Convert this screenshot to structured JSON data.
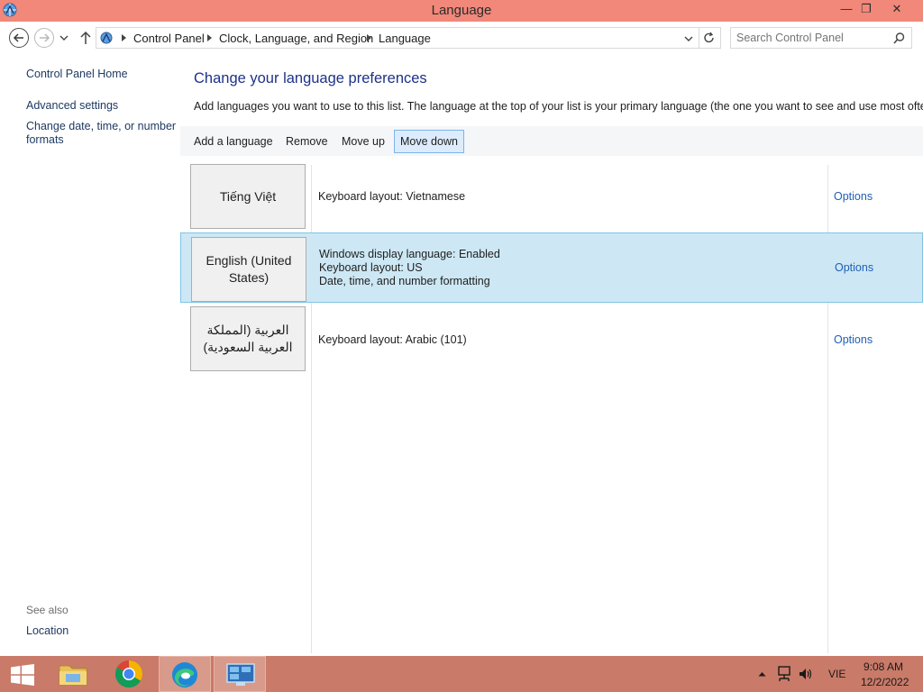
{
  "window": {
    "title": "Language",
    "minimize_glyph": "—",
    "restore_glyph": "❐",
    "close_glyph": "✕"
  },
  "address": {
    "breadcrumbs": [
      "Control Panel",
      "Clock, Language, and Region",
      "Language"
    ],
    "search_placeholder": "Search Control Panel"
  },
  "sidebar": {
    "home": "Control Panel Home",
    "links": [
      "Advanced settings",
      "Change date, time, or number formats"
    ],
    "see_also_label": "See also",
    "see_also_links": [
      "Location"
    ]
  },
  "main": {
    "heading": "Change your language preferences",
    "description": "Add languages you want to use to this list. The language at the top of your list is your primary language (the one you want to see and use most often).",
    "toolbar": [
      "Add a language",
      "Remove",
      "Move up",
      "Move down"
    ],
    "languages": [
      {
        "name": "Tiếng Việt",
        "details": [
          "Keyboard layout: Vietnamese"
        ],
        "options": "Options"
      },
      {
        "name": "English (United States)",
        "details": [
          "Windows display language: Enabled",
          "Keyboard layout: US",
          "Date, time, and number formatting"
        ],
        "options": "Options"
      },
      {
        "name": "العربية (المملكة العربية السعودية)",
        "details": [
          "Keyboard layout: Arabic (101)"
        ],
        "options": "Options"
      }
    ]
  },
  "taskbar": {
    "apps": [
      "start-button",
      "file-explorer",
      "chrome",
      "edge",
      "control-panel"
    ],
    "language_indicator": "VIE",
    "time": "9:08 AM",
    "date": "12/2/2022"
  },
  "colors": {
    "titlebar": "#f1887a",
    "taskbar": "#c97a68",
    "heading": "#1e3287",
    "link": "#1f5fb4",
    "selection": "#cde8f4"
  }
}
